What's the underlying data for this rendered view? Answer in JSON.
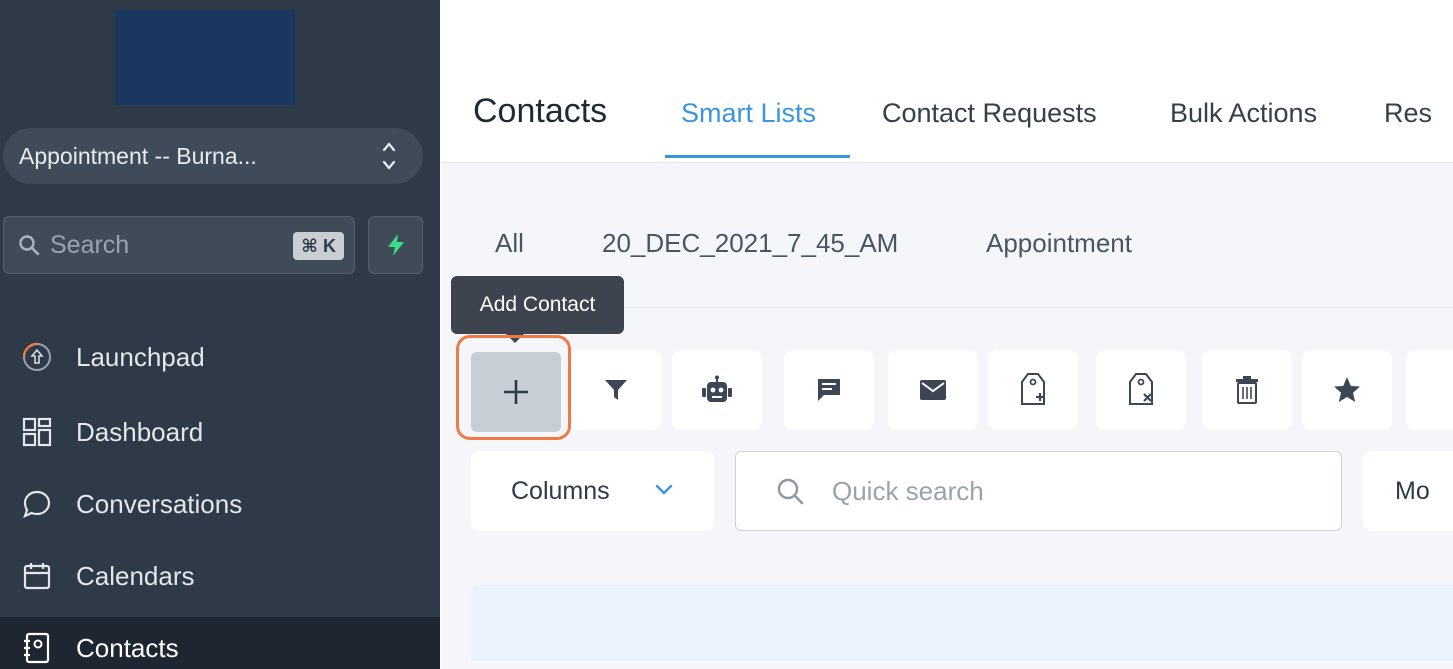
{
  "sidebar": {
    "account": "Appointment -- Burna...",
    "search_placeholder": "Search",
    "shortcut": "⌘ K",
    "nav": [
      {
        "label": "Launchpad",
        "icon": "launchpad-icon"
      },
      {
        "label": "Dashboard",
        "icon": "dashboard-icon"
      },
      {
        "label": "Conversations",
        "icon": "chat-bubble-icon"
      },
      {
        "label": "Calendars",
        "icon": "calendar-icon"
      },
      {
        "label": "Contacts",
        "icon": "contacts-book-icon",
        "active": true
      }
    ]
  },
  "header": {
    "title": "Contacts",
    "tabs": [
      "Smart Lists",
      "Contact Requests",
      "Bulk Actions",
      "Res"
    ],
    "active_tab": "Smart Lists"
  },
  "smart_lists": [
    "All",
    "20_DEC_2021_7_45_AM",
    "Appointment"
  ],
  "tooltip": "Add Contact",
  "toolbar": {
    "buttons": [
      "add-contact",
      "filter",
      "automation-bot",
      "sms-message",
      "email",
      "add-tag",
      "remove-tag",
      "delete",
      "star"
    ]
  },
  "filters": {
    "columns_label": "Columns",
    "quick_search_placeholder": "Quick search",
    "more_label": "Mo"
  },
  "colors": {
    "accent": "#3a96df",
    "sidebar_bg": "#2f3a48",
    "focus_ring": "#f07a45",
    "bolt": "#3ddc84"
  }
}
